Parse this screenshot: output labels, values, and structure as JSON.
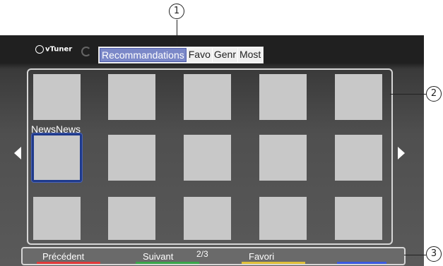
{
  "app": {
    "logo_text": "vTuner"
  },
  "tabs": [
    "Recommandations",
    "Favo",
    "Genr",
    "Most"
  ],
  "grid": {
    "selected_label": "NewsNews"
  },
  "footer": {
    "prev_label": "Précédent",
    "next_label": "Suivant",
    "page": "2/3",
    "fav_label": "Favori",
    "colors": [
      "#e03a3a",
      "#3aa64a",
      "#e0c03a",
      "#3a5ae0"
    ]
  },
  "callouts": [
    "1",
    "2",
    "3"
  ]
}
